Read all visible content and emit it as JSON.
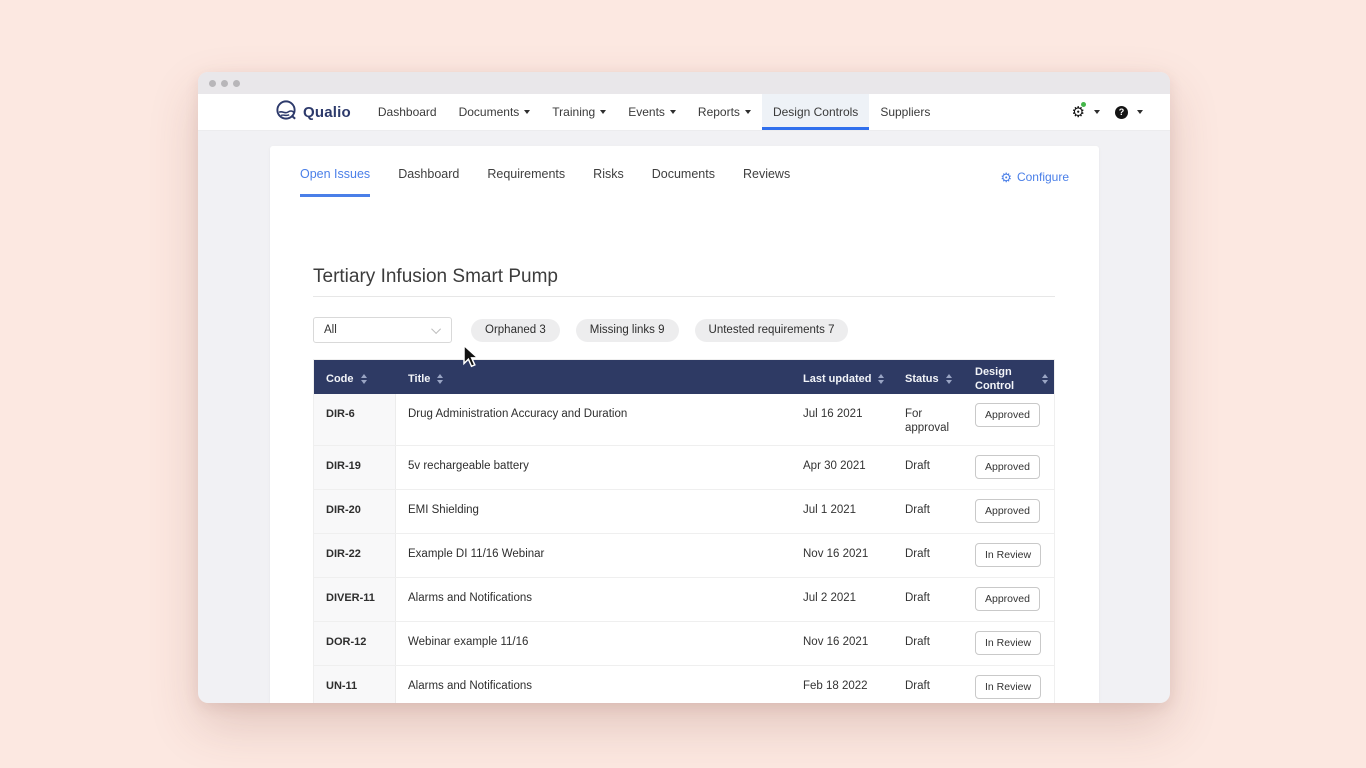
{
  "nav": {
    "logo_text": "Qualio",
    "items": [
      {
        "label": "Dashboard",
        "dropdown": false,
        "active": false
      },
      {
        "label": "Documents",
        "dropdown": true,
        "active": false
      },
      {
        "label": "Training",
        "dropdown": true,
        "active": false
      },
      {
        "label": "Events",
        "dropdown": true,
        "active": false
      },
      {
        "label": "Reports",
        "dropdown": true,
        "active": false
      },
      {
        "label": "Design Controls",
        "dropdown": false,
        "active": true
      },
      {
        "label": "Suppliers",
        "dropdown": false,
        "active": false
      }
    ],
    "right_icons": [
      {
        "name": "settings-gear-icon",
        "has_notification_dot": true,
        "dropdown": true
      },
      {
        "name": "help-icon",
        "glyph": "?",
        "dropdown": true
      }
    ]
  },
  "tabs": {
    "items": [
      {
        "label": "Open Issues",
        "active": true
      },
      {
        "label": "Dashboard",
        "active": false
      },
      {
        "label": "Requirements",
        "active": false
      },
      {
        "label": "Risks",
        "active": false
      },
      {
        "label": "Documents",
        "active": false
      },
      {
        "label": "Reviews",
        "active": false
      }
    ],
    "configure_label": "Configure"
  },
  "content": {
    "title": "Tertiary Infusion Smart Pump",
    "filter": {
      "selected_value": "All",
      "chips": [
        "Orphaned 3",
        "Missing links 9",
        "Untested requirements 7"
      ]
    },
    "table": {
      "columns": [
        {
          "label": "Code",
          "sortable": true
        },
        {
          "label": "Title",
          "sortable": true
        },
        {
          "label": "Last updated",
          "sortable": true
        },
        {
          "label": "Status",
          "sortable": true
        },
        {
          "label": "Design Control",
          "sortable": true
        }
      ],
      "rows": [
        {
          "code": "DIR-6",
          "title": "Drug Administration Accuracy and Duration",
          "last_updated": "Jul 16 2021",
          "status": "For approval",
          "design_control": "Approved"
        },
        {
          "code": "DIR-19",
          "title": "5v rechargeable battery",
          "last_updated": "Apr 30 2021",
          "status": "Draft",
          "design_control": "Approved"
        },
        {
          "code": "DIR-20",
          "title": "EMI Shielding",
          "last_updated": "Jul 1 2021",
          "status": "Draft",
          "design_control": "Approved"
        },
        {
          "code": "DIR-22",
          "title": "Example DI 11/16 Webinar",
          "last_updated": "Nov 16 2021",
          "status": "Draft",
          "design_control": "In Review"
        },
        {
          "code": "DIVER-11",
          "title": "Alarms and Notifications",
          "last_updated": "Jul 2 2021",
          "status": "Draft",
          "design_control": "Approved"
        },
        {
          "code": "DOR-12",
          "title": "Webinar example 11/16",
          "last_updated": "Nov 16 2021",
          "status": "Draft",
          "design_control": "In Review"
        },
        {
          "code": "UN-11",
          "title": "Alarms and Notifications",
          "last_updated": "Feb 18 2022",
          "status": "Draft",
          "design_control": "In Review"
        }
      ]
    }
  },
  "colors": {
    "page_background": "#fce8e1",
    "accent_blue": "#4a7fe8",
    "nav_active_underline": "#2f6fed",
    "table_header_navy": "#2e3a64",
    "notification_green": "#43b649",
    "logo_navy": "#2d3a6b"
  }
}
